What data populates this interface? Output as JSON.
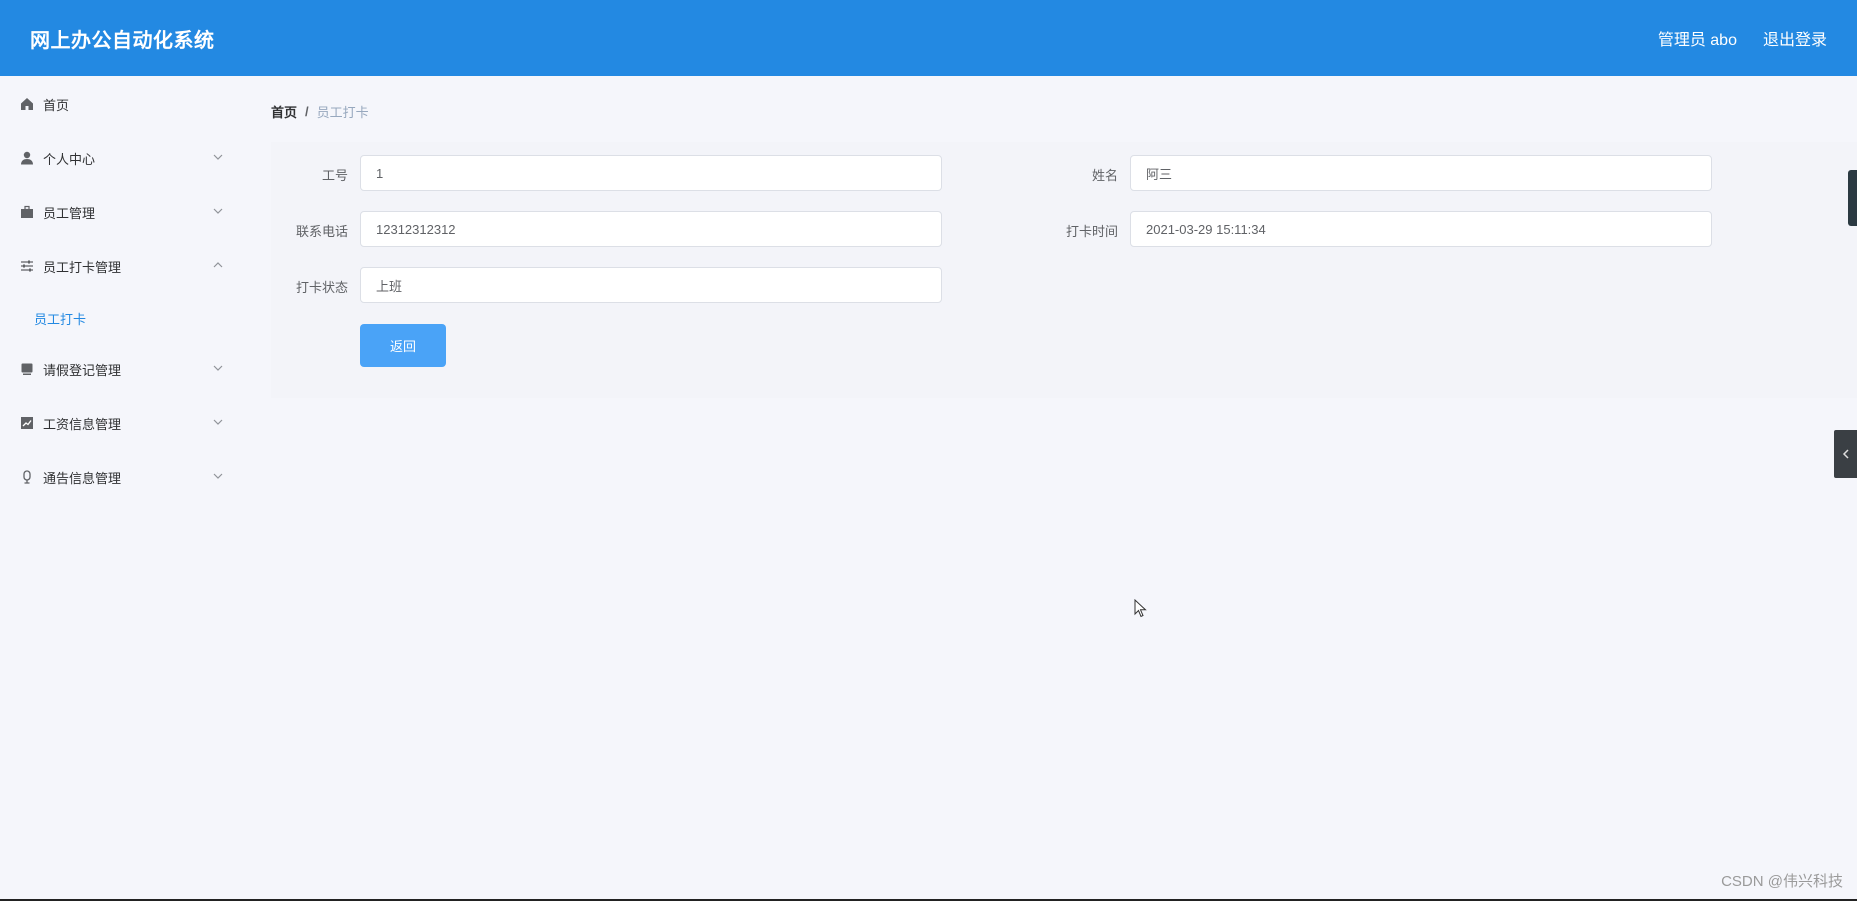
{
  "header": {
    "app_title": "网上办公自动化系统",
    "user_label": "管理员 abo",
    "logout_label": "退出登录",
    "bg_color": "#2389e2"
  },
  "sidebar": {
    "items": [
      {
        "label": "首页",
        "icon": "home-icon",
        "expandable": false
      },
      {
        "label": "个人中心",
        "icon": "user-icon",
        "expandable": true,
        "expanded": false
      },
      {
        "label": "员工管理",
        "icon": "briefcase-icon",
        "expandable": true,
        "expanded": false
      },
      {
        "label": "员工打卡管理",
        "icon": "sliders-icon",
        "expandable": true,
        "expanded": true
      },
      {
        "label": "请假登记管理",
        "icon": "document-icon",
        "expandable": true,
        "expanded": false
      },
      {
        "label": "工资信息管理",
        "icon": "chart-icon",
        "expandable": true,
        "expanded": false
      },
      {
        "label": "通告信息管理",
        "icon": "microphone-icon",
        "expandable": true,
        "expanded": false
      }
    ],
    "submenu": {
      "label": "员工打卡",
      "active": true
    }
  },
  "breadcrumb": {
    "home": "首页",
    "separator": "/",
    "current": "员工打卡"
  },
  "form": {
    "employee_no": {
      "label": "工号",
      "value": "1"
    },
    "name": {
      "label": "姓名",
      "value": "阿三"
    },
    "phone": {
      "label": "联系电话",
      "value": "12312312312"
    },
    "checkin_time": {
      "label": "打卡时间",
      "value": "2021-03-29 15:11:34"
    },
    "checkin_status": {
      "label": "打卡状态",
      "value": "上班"
    },
    "back_button": "返回"
  },
  "watermark": "CSDN @伟兴科技"
}
